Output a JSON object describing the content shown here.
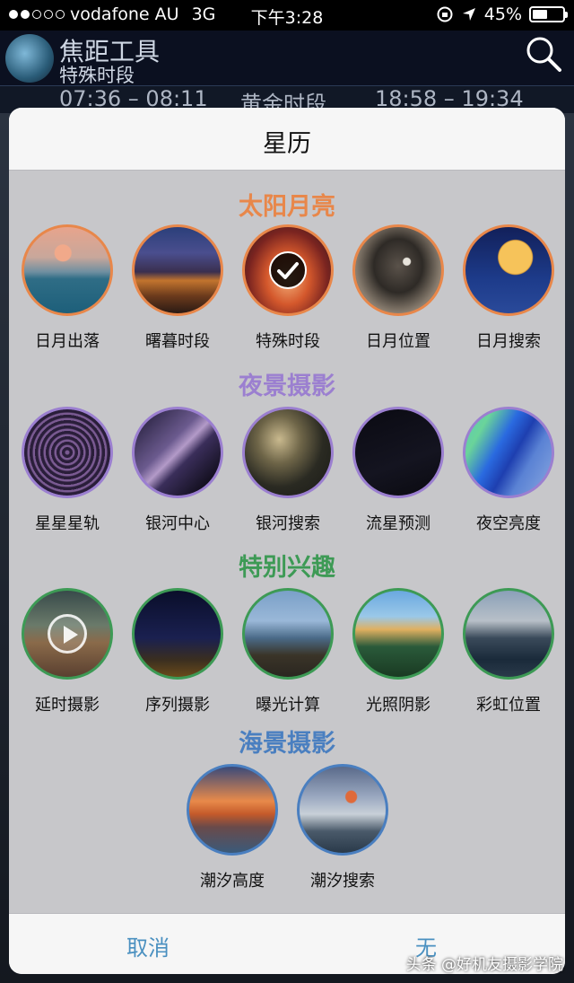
{
  "status_bar": {
    "carrier": "vodafone AU",
    "network": "3G",
    "time": "下午3:28",
    "battery": "45%",
    "battery_level": 0.45,
    "signal_bars": 2
  },
  "app": {
    "title": "焦距工具",
    "subtitle": "特殊时段",
    "strip_left": "07:36 – 08:11",
    "strip_center": "黄金时段",
    "strip_right": "18:58 – 19:34"
  },
  "sheet": {
    "title": "星历",
    "sections": [
      {
        "title": "太阳月亮",
        "color": "#e8874a",
        "ring": "#e8874a",
        "items": [
          {
            "label": "日月出落",
            "icon": "sunrise-mountain-icon"
          },
          {
            "label": "曙暮时段",
            "icon": "city-twilight-icon"
          },
          {
            "label": "特殊时段",
            "icon": "golden-sky-icon",
            "selected": true
          },
          {
            "label": "日月位置",
            "icon": "moon-cloud-icon"
          },
          {
            "label": "日月搜索",
            "icon": "full-moon-building-icon"
          }
        ]
      },
      {
        "title": "夜景摄影",
        "color": "#9b7fd0",
        "ring": "#9b7fd0",
        "items": [
          {
            "label": "星星星轨",
            "icon": "star-trails-icon"
          },
          {
            "label": "银河中心",
            "icon": "milky-way-icon"
          },
          {
            "label": "银河搜索",
            "icon": "milky-way-search-icon"
          },
          {
            "label": "流星预测",
            "icon": "meteor-icon"
          },
          {
            "label": "夜空亮度",
            "icon": "sky-brightness-map-icon"
          }
        ]
      },
      {
        "title": "特别兴趣",
        "color": "#3d9a55",
        "ring": "#3d9a55",
        "items": [
          {
            "label": "延时摄影",
            "icon": "timelapse-play-icon"
          },
          {
            "label": "序列摄影",
            "icon": "sequence-bridge-icon"
          },
          {
            "label": "曝光计算",
            "icon": "long-exposure-rocks-icon"
          },
          {
            "label": "光照阴影",
            "icon": "half-dome-light-icon"
          },
          {
            "label": "彩虹位置",
            "icon": "rainbow-lake-icon"
          }
        ]
      },
      {
        "title": "海景摄影",
        "color": "#4a7fc0",
        "ring": "#4a7fc0",
        "items": [
          {
            "label": "潮汐高度",
            "icon": "sea-stacks-sunset-icon"
          },
          {
            "label": "潮汐搜索",
            "icon": "tide-sunset-icon"
          }
        ]
      }
    ],
    "cancel_label": "取消",
    "none_label": "无"
  },
  "watermark": "头条 @好机友摄影学院"
}
